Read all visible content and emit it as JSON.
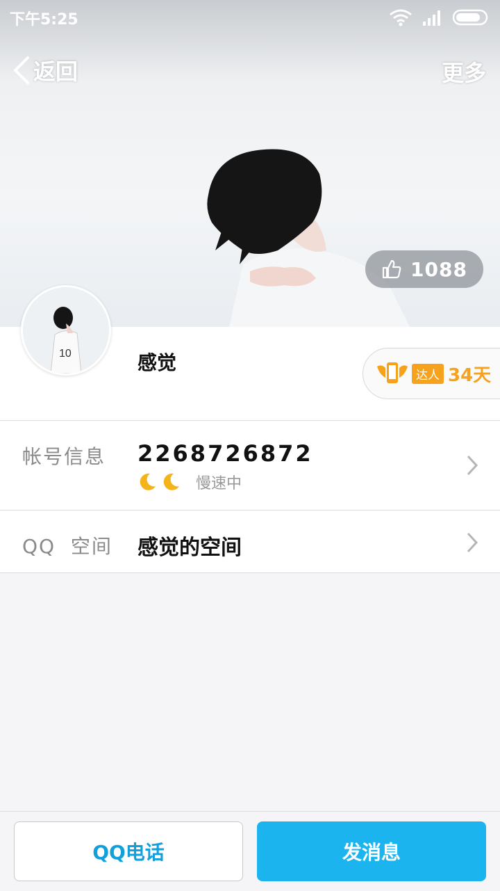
{
  "status_bar": {
    "time": "下午5:25",
    "icons": [
      "wifi-icon",
      "signal-icon",
      "battery-icon"
    ]
  },
  "nav": {
    "back_label": "返回",
    "more_label": "更多"
  },
  "cover": {
    "like_count": "1088",
    "like_icon": "thumbs-up-icon"
  },
  "profile": {
    "nickname": "感觉",
    "vip": {
      "badge": "达人",
      "days": "34天"
    }
  },
  "rows": [
    {
      "label": "帐号信息",
      "value": "2268726872",
      "sub_text": "慢速中",
      "moons": 2
    },
    {
      "label": "QQ  空间",
      "value": "感觉的空间"
    }
  ],
  "actions": {
    "call_label": "QQ电话",
    "message_label": "发消息"
  },
  "colors": {
    "accent": "#1bb4ee",
    "call_text": "#12a0dc",
    "vip": "#f6a21d"
  }
}
